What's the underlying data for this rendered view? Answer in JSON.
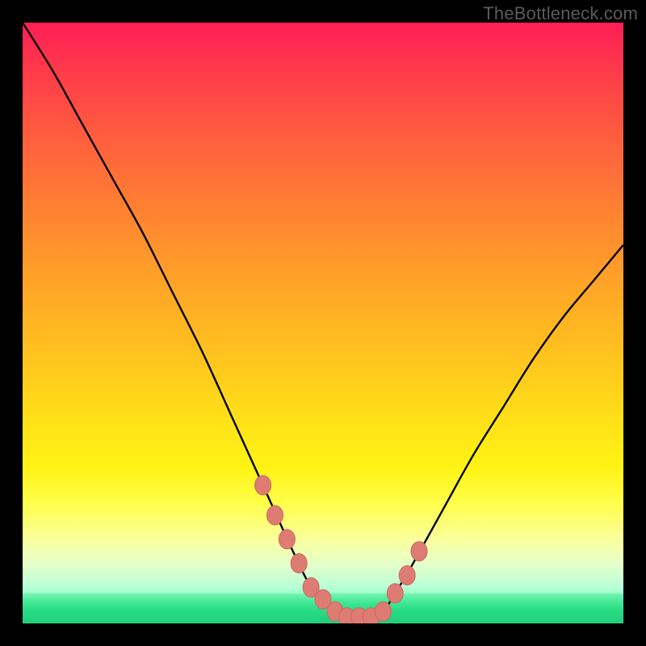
{
  "watermark": "TheBottleneck.com",
  "colors": {
    "frame": "#000000",
    "curve": "#000000",
    "marker_fill": "#DE7B72",
    "marker_stroke": "#C96A62",
    "gradient_top": "#FF1E56",
    "gradient_bottom": "#21E27E"
  },
  "chart_data": {
    "type": "line",
    "title": "",
    "xlabel": "",
    "ylabel": "",
    "xlim": [
      0,
      100
    ],
    "ylim": [
      0,
      100
    ],
    "grid": false,
    "legend": false,
    "series": [
      {
        "name": "bottleneck-curve",
        "x": [
          0,
          5,
          10,
          15,
          20,
          25,
          30,
          35,
          40,
          45,
          48,
          50,
          52,
          55,
          58,
          60,
          62,
          65,
          70,
          75,
          80,
          85,
          90,
          95,
          100
        ],
        "values": [
          100,
          92,
          83,
          74,
          65,
          55,
          45,
          34,
          23,
          12,
          6,
          4,
          2,
          1,
          1,
          2,
          5,
          10,
          19,
          28,
          36,
          44,
          51,
          57,
          63
        ]
      }
    ],
    "markers": {
      "name": "highlighted-points",
      "x": [
        40,
        42,
        44,
        46,
        48,
        50,
        52,
        54,
        56,
        58,
        60,
        62,
        64,
        66
      ],
      "values": [
        23,
        18,
        14,
        10,
        6,
        4,
        2,
        1,
        1,
        1,
        2,
        5,
        8,
        12
      ]
    }
  }
}
